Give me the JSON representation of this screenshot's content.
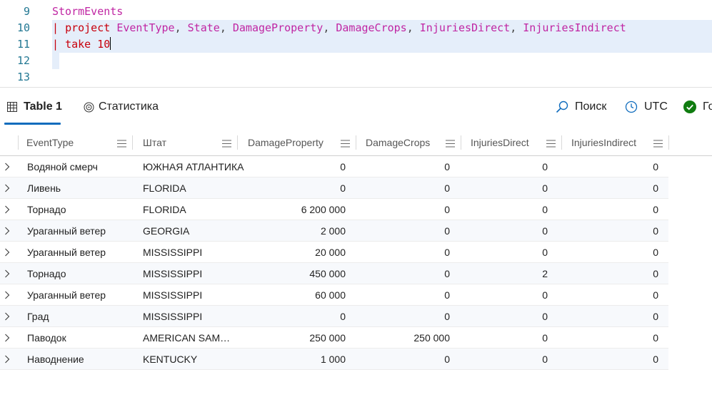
{
  "editor": {
    "lines": [
      {
        "num": "9",
        "text": "StormEvents"
      },
      {
        "num": "10",
        "text": "| project EventType, State, DamageProperty, DamageCrops, InjuriesDirect, InjuriesIndirect"
      },
      {
        "num": "11",
        "text": "| take 10"
      },
      {
        "num": "12",
        "text": ""
      },
      {
        "num": "13",
        "text": ""
      }
    ],
    "tokens": {
      "table": "StormEvents",
      "pipe": "|",
      "project": "project",
      "columns": [
        "EventType",
        "State",
        "DamageProperty",
        "DamageCrops",
        "InjuriesDirect",
        "InjuriesIndirect"
      ],
      "comma": ",",
      "take": "take",
      "take_count": "10"
    }
  },
  "toolbar": {
    "tab_table": "Table 1",
    "tab_stats": "Статистика",
    "search": "Поиск",
    "utc": "UTC",
    "status": "Го"
  },
  "colors": {
    "accent": "#0f6cbd",
    "status_ok": "#107c10",
    "keyword_magenta": "#c026a3",
    "keyword_red": "#c8000c",
    "line_number": "#237893"
  },
  "icons": {
    "table_tab": "table-grid-icon",
    "stats_tab": "statistics-target-icon",
    "search": "search-icon",
    "utc": "clock-icon",
    "status": "checkmark-circle-icon",
    "column_menu": "hamburger-menu-icon",
    "row_expand": "chevron-right-icon"
  },
  "table": {
    "columns": [
      "EventType",
      "Штат",
      "DamageProperty",
      "DamageCrops",
      "InjuriesDirect",
      "InjuriesIndirect"
    ],
    "rows": [
      [
        "Водяной смерч",
        "ЮЖНАЯ АТЛАНТИКА",
        "0",
        "0",
        "0",
        "0"
      ],
      [
        "Ливень",
        "FLORIDA",
        "0",
        "0",
        "0",
        "0"
      ],
      [
        "Торнадо",
        "FLORIDA",
        "6 200 000",
        "0",
        "0",
        "0"
      ],
      [
        "Ураганный ветер",
        "GEORGIA",
        "2 000",
        "0",
        "0",
        "0"
      ],
      [
        "Ураганный ветер",
        "MISSISSIPPI",
        "20 000",
        "0",
        "0",
        "0"
      ],
      [
        "Торнадо",
        "MISSISSIPPI",
        "450 000",
        "0",
        "2",
        "0"
      ],
      [
        "Ураганный ветер",
        "MISSISSIPPI",
        "60 000",
        "0",
        "0",
        "0"
      ],
      [
        "Град",
        "MISSISSIPPI",
        "0",
        "0",
        "0",
        "0"
      ],
      [
        "Паводок",
        "AMERICAN SAM…",
        "250 000",
        "250 000",
        "0",
        "0"
      ],
      [
        "Наводнение",
        "KENTUCKY",
        "1 000",
        "0",
        "0",
        "0"
      ]
    ]
  }
}
